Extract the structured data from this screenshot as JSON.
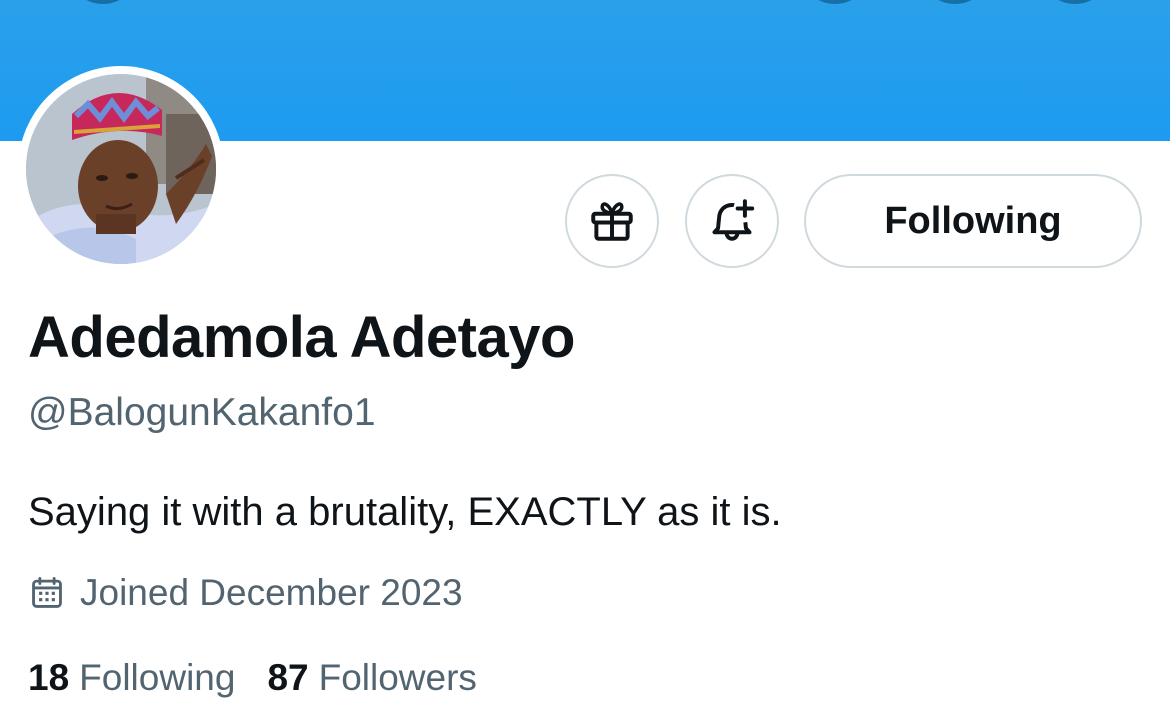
{
  "banner": {
    "color": "#1d9bf0"
  },
  "profile": {
    "display_name": "Adedamola Adetayo",
    "handle": "@BalogunKakanfo1",
    "bio": "Saying it with a brutality, EXACTLY as it is.",
    "joined": "Joined December 2023",
    "stats": {
      "following_count": "18",
      "following_label": "Following",
      "followers_count": "87",
      "followers_label": "Followers"
    }
  },
  "actions": {
    "gift_icon": "gift-icon",
    "notify_icon": "bell-plus-icon",
    "follow_label": "Following"
  },
  "icons": {
    "calendar": "calendar-icon"
  },
  "colors": {
    "text_primary": "#0f1419",
    "text_secondary": "#536471",
    "border": "#cfd9de"
  }
}
